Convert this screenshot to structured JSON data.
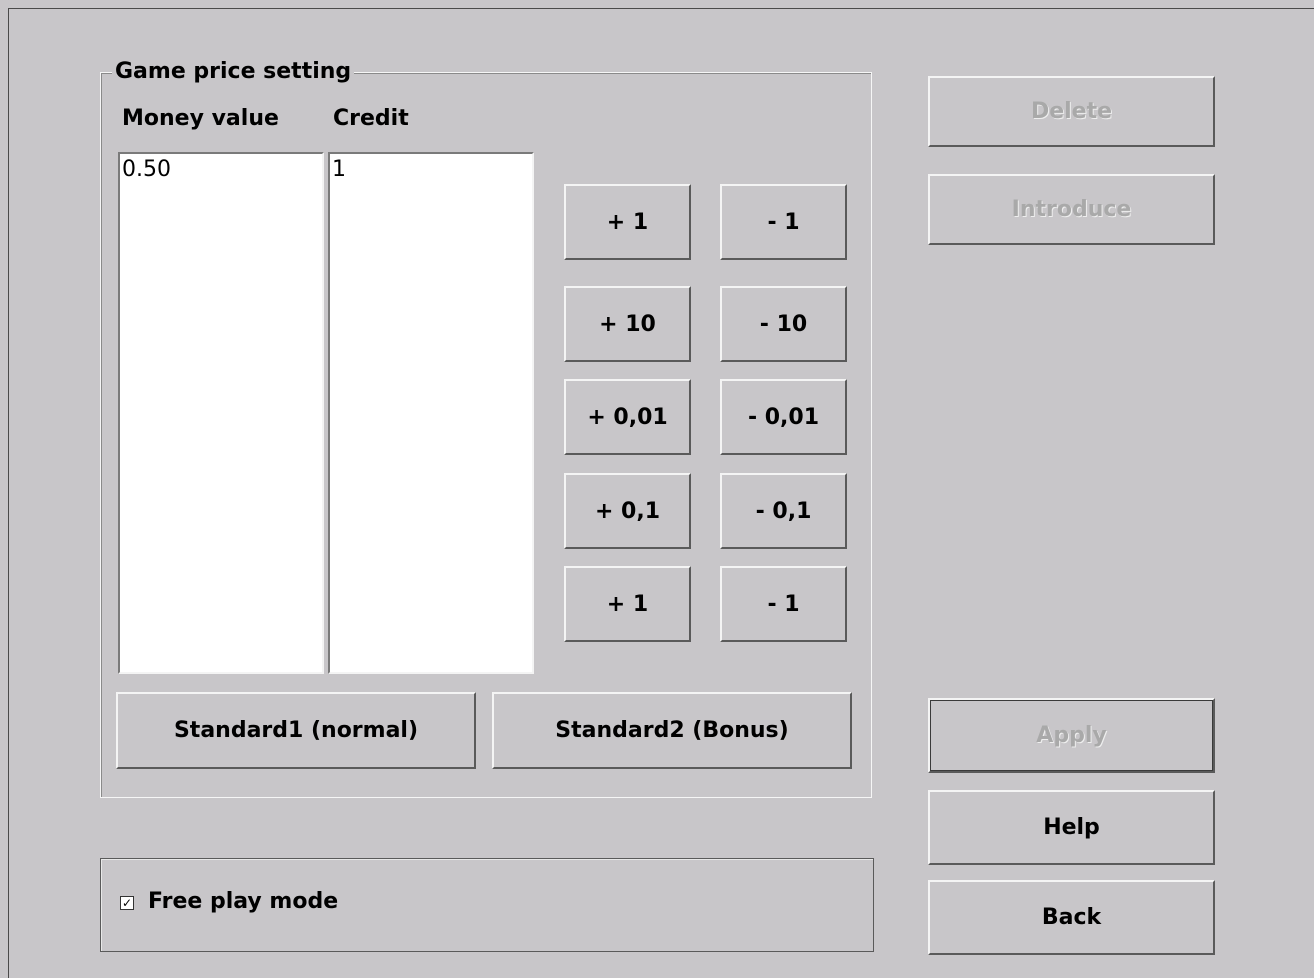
{
  "game_price": {
    "title": "Game price setting",
    "columns": {
      "money_value": "Money value",
      "credit": "Credit"
    },
    "money_values": [
      "0.50"
    ],
    "credits": [
      "1"
    ],
    "adjust_buttons": [
      {
        "plus": "+ 1",
        "minus": "- 1"
      },
      {
        "plus": "+ 10",
        "minus": "- 10"
      },
      {
        "plus": "+ 0,01",
        "minus": "- 0,01"
      },
      {
        "plus": "+ 0,1",
        "minus": "- 0,1"
      },
      {
        "plus": "+ 1",
        "minus": "- 1"
      }
    ],
    "standard1_label": "Standard1 (normal)",
    "standard2_label": "Standard2 (Bonus)"
  },
  "side_buttons": {
    "delete": "Delete",
    "introduce": "Introduce",
    "apply": "Apply",
    "help": "Help",
    "back": "Back"
  },
  "free_play": {
    "label": "Free play mode",
    "checked": true,
    "check_glyph": "✓"
  }
}
